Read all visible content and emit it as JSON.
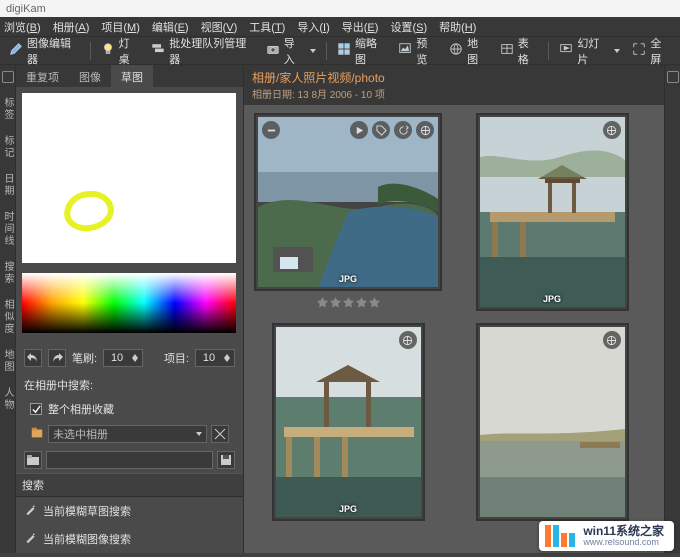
{
  "app": {
    "title": "digiKam"
  },
  "menu": {
    "browse": {
      "label": "浏览",
      "key": "B"
    },
    "album": {
      "label": "相册",
      "key": "A"
    },
    "item": {
      "label": "项目",
      "key": "M"
    },
    "edit": {
      "label": "编辑",
      "key": "E"
    },
    "view": {
      "label": "视图",
      "key": "V"
    },
    "tools": {
      "label": "工具",
      "key": "T"
    },
    "import": {
      "label": "导入",
      "key": "I"
    },
    "export": {
      "label": "导出",
      "key": "E"
    },
    "settings": {
      "label": "设置",
      "key": "S"
    },
    "help": {
      "label": "帮助",
      "key": "H"
    }
  },
  "toolbar": {
    "image_editor": "图像编辑器",
    "light_table": "灯桌",
    "batch_queue": "批处理队列管理器",
    "import": "导入",
    "thumbnails": "缩略图",
    "preview": "预览",
    "map": "地图",
    "table": "表格",
    "slideshow": "幻灯片",
    "fullscreen": "全屏"
  },
  "left_tabs": [
    "标签",
    "标记",
    "日期",
    "时间线",
    "搜索",
    "相似度",
    "地图",
    "人物"
  ],
  "sidebar": {
    "tabs": {
      "dup": "重复项",
      "image": "图像",
      "sketch": "草图"
    },
    "undo_icon": "undo-icon",
    "redo_icon": "redo-icon",
    "brush_label": "笔刷:",
    "brush_value": "10",
    "items_label": "项目:",
    "items_value": "10",
    "search_label": "在相册中搜索:",
    "whole_album": "整个相册收藏",
    "combo_icon": "album-icon",
    "combo_text": "未选中相册",
    "file_icon": "folder-icon",
    "save_icon": "save-icon",
    "reset_icon": "reset-icon",
    "search_header": "搜索",
    "search_sketch": "当前模糊草图搜索",
    "search_image": "当前模糊图像搜索"
  },
  "gallery": {
    "breadcrumb": "相册/家人照片视频/photo",
    "subtitle": "相册日期: 13 8月 2006 - 10 项",
    "format": "JPG",
    "photos": [
      {
        "id": "coast",
        "big_overlay": true
      },
      {
        "id": "pavilion",
        "big_overlay": false
      },
      {
        "id": "pavilion2",
        "big_overlay": false
      },
      {
        "id": "riverfog",
        "big_overlay": false
      }
    ]
  },
  "icons": {
    "minus": "minus-icon",
    "play": "play-icon",
    "tag": "tag-icon",
    "bolt": "bolt-icon",
    "globe": "globe-icon"
  },
  "watermark": {
    "line1": "win11系统之家",
    "line2": "www.relsound.com"
  }
}
